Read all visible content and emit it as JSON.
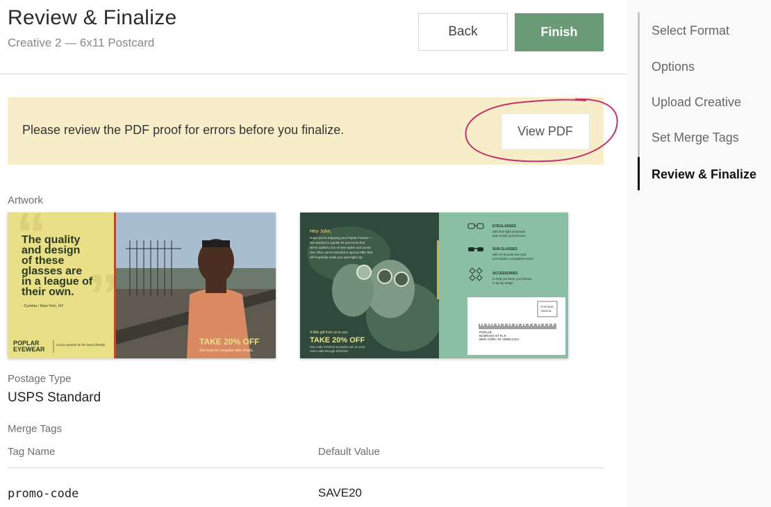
{
  "header": {
    "title": "Review & Finalize",
    "subtitle": "Creative 2 — 6x11 Postcard",
    "back_label": "Back",
    "finish_label": "Finish"
  },
  "notice": {
    "text": "Please review the PDF proof for errors before you finalize.",
    "view_pdf_label": "View PDF"
  },
  "artwork": {
    "label": "Artwork",
    "front": {
      "quote_l1": "The quality",
      "quote_l2": "and design",
      "quote_l3": "of these",
      "quote_l4": "glasses are",
      "quote_l5": "in a league of",
      "quote_l6": "their own.",
      "attribution": "- Cynthia / New York, NY",
      "brand_l1": "POPLAR",
      "brand_l2": "EYEWEAR",
      "tagline": "Luxury eyewear for the luxury lifestyle.",
      "offer": "TAKE 20% OFF",
      "offer_note": "See back for complete offer details."
    },
    "back": {
      "greeting": "Hey John,",
      "body_1": "Hope you're enjoying your Poplar Frames —",
      "body_2": "We wanted to quickly let you know that",
      "body_3": "we've added a ton of new styles and acces-",
      "body_4": "ries. Plus, we've included a special offer that",
      "body_5": "will hopefully make you eyes light up!",
      "gift_text": "A little gift from us to you",
      "offer": "TAKE 20% OFF",
      "promo_1": "Use code SAVE20 at poplar.com on your",
      "promo_2": "order valid through 06/30/20.",
      "feature_1_title": "EYEGLASSES",
      "feature_1_desc_1": "with blue-light protection",
      "feature_1_desc_2": "and scratch proof lenses",
      "feature_2_title": "SUN GLASSES",
      "feature_2_desc_1": "with UV-B protection and",
      "feature_2_desc_2": "prescription compatible lenses",
      "feature_3_title": "ACCESSORIES",
      "feature_3_desc_1": "to help you keep your frames",
      "feature_3_desc_2": "in tip top shape",
      "postage_indicia_1": "POSTAGE",
      "postage_indicia_2": "INDICIA",
      "address_1": "POPLAR",
      "address_2": "55 BROAD ST FL 9",
      "address_3": "NEW YORK, NY 10004-2414"
    }
  },
  "postage": {
    "label": "Postage Type",
    "value": "USPS Standard"
  },
  "merge_tags": {
    "label": "Merge Tags",
    "col_tag_name": "Tag Name",
    "col_default_value": "Default Value",
    "rows": [
      {
        "tag": "promo-code",
        "value": "SAVE20"
      }
    ]
  },
  "steps": [
    {
      "label": "Select Format",
      "active": false
    },
    {
      "label": "Options",
      "active": false
    },
    {
      "label": "Upload Creative",
      "active": false
    },
    {
      "label": "Set Merge Tags",
      "active": false
    },
    {
      "label": "Review & Finalize",
      "active": true
    }
  ],
  "colors": {
    "finish_button": "#6b9a76",
    "notice_background": "#f8edc9",
    "annotation_circle": "#c4306a",
    "card_yellow": "#e9df86",
    "card_green": "#8bbfa3",
    "card_text_dark": "#2b3a22",
    "offer_yellow": "#e9e28a"
  }
}
